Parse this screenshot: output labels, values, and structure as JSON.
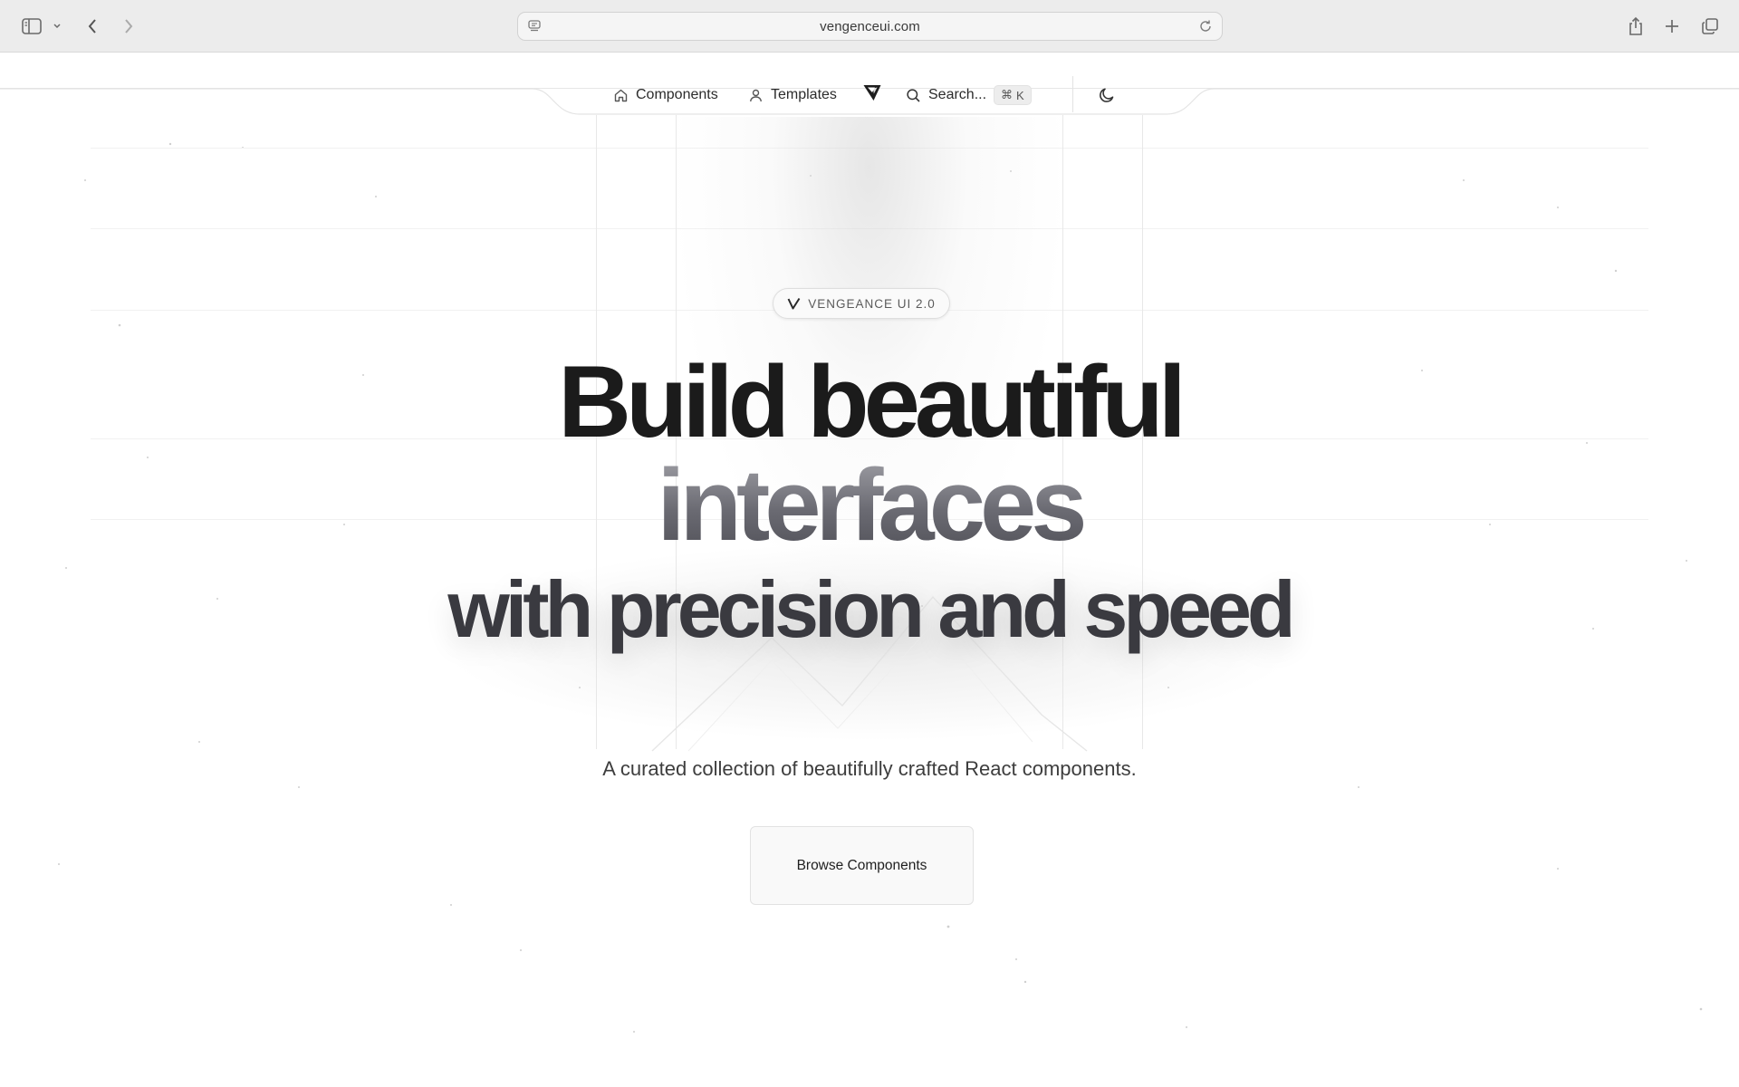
{
  "browser": {
    "url": "vengenceui.com"
  },
  "nav": {
    "components_label": "Components",
    "templates_label": "Templates",
    "search_label": "Search...",
    "search_shortcut_symbol": "⌘",
    "search_shortcut_key": "K"
  },
  "hero": {
    "badge_text": "VENGEANCE UI 2.0",
    "headline_line1": "Build beautiful",
    "headline_line2": "interfaces",
    "headline_line3": "with precision and speed",
    "subtitle": "A curated collection of beautifully crafted React components.",
    "cta_label": "Browse Components"
  }
}
